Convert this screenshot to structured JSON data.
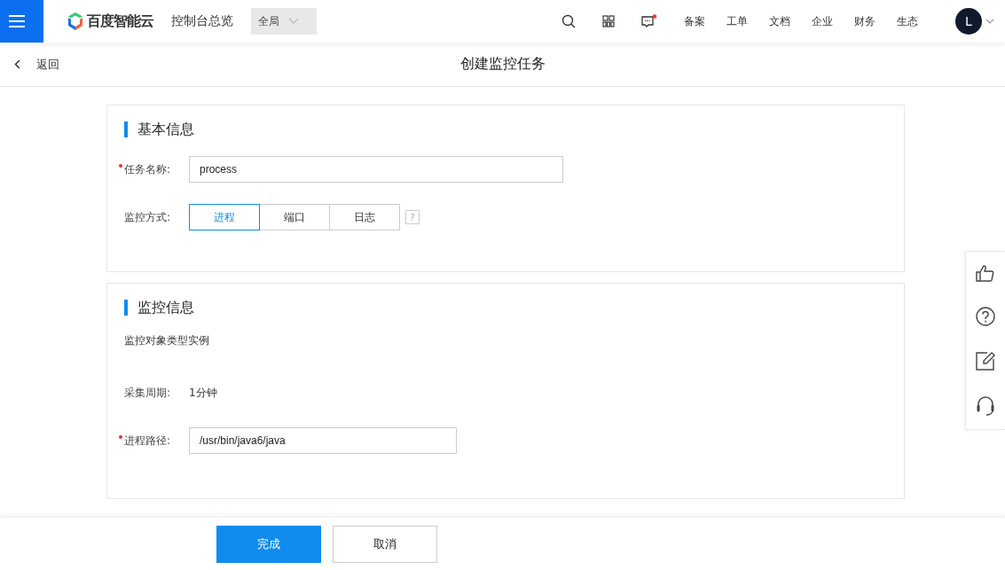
{
  "topbar": {
    "logo_text": "百度智能云",
    "console_link": "控制台总览",
    "region": "全局",
    "nav": [
      "备案",
      "工单",
      "文档",
      "企业",
      "财务",
      "生态"
    ],
    "avatar": "L",
    "message_unread": true
  },
  "page": {
    "back": "返回",
    "title": "创建监控任务"
  },
  "sections": [
    {
      "title": "基本信息",
      "rows": [
        {
          "kind": "input",
          "label": "任务名称:",
          "required": true,
          "value": "process"
        },
        {
          "kind": "segmented",
          "label": "监控方式:",
          "required": false,
          "help": "?",
          "options": [
            {
              "label": "进程",
              "selected": true
            },
            {
              "label": "端口",
              "selected": false
            },
            {
              "label": "日志",
              "selected": false
            }
          ]
        }
      ]
    },
    {
      "title": "监控信息",
      "rows": [
        {
          "kind": "note",
          "text": "监控对象类型实例"
        },
        {
          "kind": "static",
          "label": "采集周期:",
          "required": false,
          "value": "1分钟"
        },
        {
          "kind": "input",
          "label": "进程路径:",
          "required": true,
          "value": "/usr/bin/java6/java"
        }
      ]
    }
  ],
  "footer": {
    "buttons": [
      {
        "label": "完成",
        "primary": true
      },
      {
        "label": "取消",
        "primary": false
      }
    ]
  }
}
